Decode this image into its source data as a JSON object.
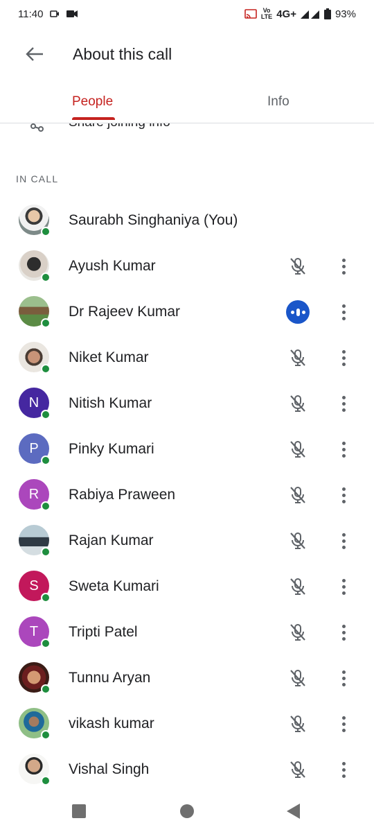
{
  "status_bar": {
    "time": "11:40",
    "network": "4G+",
    "battery": "93%",
    "icons": [
      "screen-record-icon",
      "video-icon",
      "cast-icon",
      "volte-icon",
      "signal-icon",
      "battery-icon"
    ]
  },
  "app_bar": {
    "title": "About this call",
    "back_icon": "arrow-back-icon"
  },
  "tabs": [
    {
      "label": "People",
      "active": true
    },
    {
      "label": "Info",
      "active": false
    }
  ],
  "share_row": {
    "label": "Share joining info"
  },
  "section_label": "IN CALL",
  "participants": [
    {
      "name": "Saurabh Singhaniya (You)",
      "initial": "",
      "avatar": "photo",
      "mic": "none"
    },
    {
      "name": "Ayush Kumar",
      "initial": "",
      "avatar": "photo",
      "mic": "muted"
    },
    {
      "name": "Dr Rajeev Kumar",
      "initial": "",
      "avatar": "photo",
      "mic": "speaking"
    },
    {
      "name": "Niket Kumar",
      "initial": "",
      "avatar": "photo",
      "mic": "muted"
    },
    {
      "name": "Nitish Kumar",
      "initial": "N",
      "avatar": "#4527a0",
      "mic": "muted"
    },
    {
      "name": "Pinky Kumari",
      "initial": "P",
      "avatar": "#5c6bc0",
      "mic": "muted"
    },
    {
      "name": "Rabiya Praween",
      "initial": "R",
      "avatar": "#ab47bc",
      "mic": "muted"
    },
    {
      "name": "Rajan Kumar",
      "initial": "",
      "avatar": "photo",
      "mic": "muted"
    },
    {
      "name": "Sweta Kumari",
      "initial": "S",
      "avatar": "#c2185b",
      "mic": "muted"
    },
    {
      "name": "Tripti Patel",
      "initial": "T",
      "avatar": "#ab47bc",
      "mic": "muted"
    },
    {
      "name": "Tunnu Aryan",
      "initial": "",
      "avatar": "photo",
      "mic": "muted"
    },
    {
      "name": "vikash kumar",
      "initial": "",
      "avatar": "photo",
      "mic": "muted"
    },
    {
      "name": "Vishal Singh",
      "initial": "",
      "avatar": "photo",
      "mic": "muted"
    }
  ],
  "colors": {
    "accent": "#c5221f",
    "online": "#1e8e3e",
    "speaking": "#1a56c9",
    "icon_gray": "#5f6368"
  }
}
